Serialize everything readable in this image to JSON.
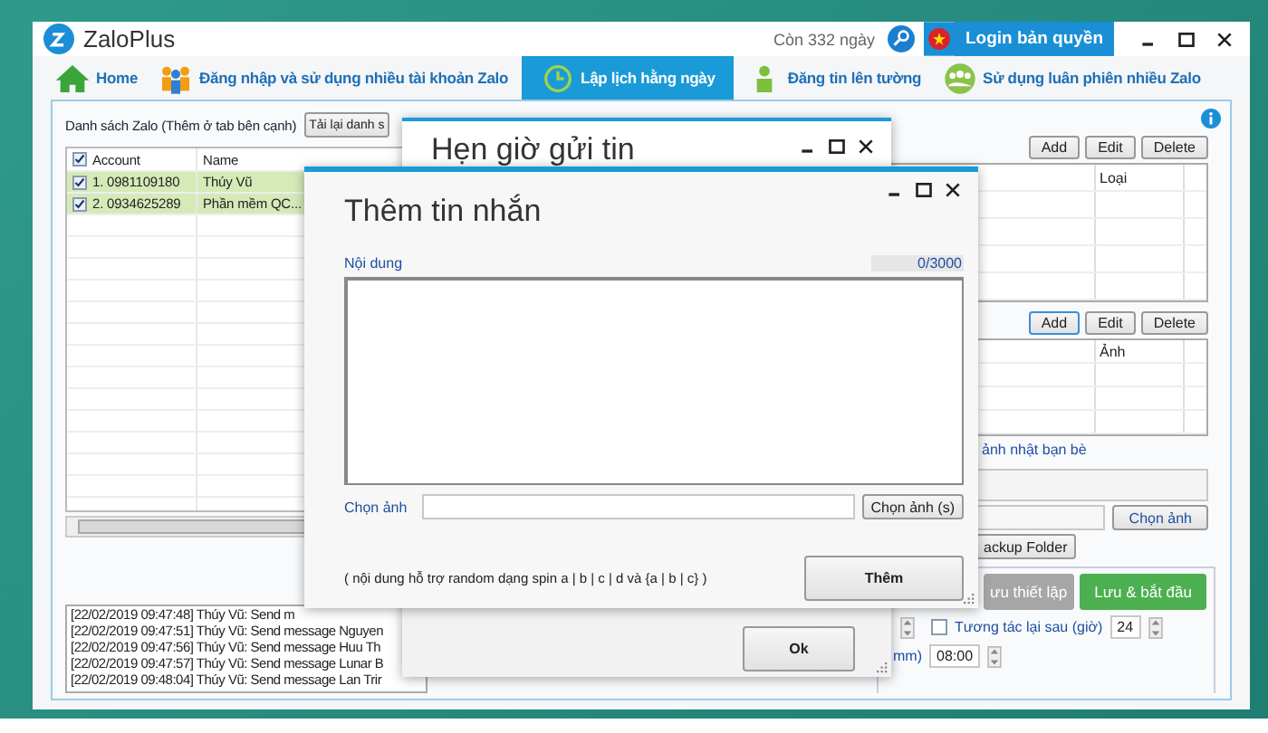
{
  "window": {
    "title": "ZaloPlus",
    "license_days": "Còn 332 ngày",
    "license_button": "Login bản quyền"
  },
  "tabs": [
    {
      "label": "Home",
      "selected": false
    },
    {
      "label": "Đăng nhập và sử dụng nhiều tài khoản Zalo",
      "selected": false
    },
    {
      "label": "Lập lịch hằng ngày",
      "selected": true
    },
    {
      "label": "Đăng tin lên tường",
      "selected": false
    },
    {
      "label": "Sử dụng luân phiên nhiều Zalo",
      "selected": false
    }
  ],
  "accounts_panel": {
    "title": "Danh sách Zalo (Thêm ở tab bên cạnh)",
    "reload_button": "Tải lại danh s",
    "header_checked": true,
    "columns": [
      "Account",
      "Name"
    ],
    "rows": [
      {
        "account": "1. 0981109180",
        "name": "Thúy Vũ",
        "checked": true
      },
      {
        "account": "2. 0934625289",
        "name": "Phần mềm QC...",
        "checked": true
      }
    ]
  },
  "log": [
    "[22/02/2019 09:47:48] Thúy Vũ: Send m",
    "[22/02/2019 09:47:51] Thúy Vũ: Send message Nguyen",
    "[22/02/2019 09:47:56] Thúy Vũ: Send message Huu Th",
    "[22/02/2019 09:47:57] Thúy Vũ: Send message Lunar B",
    "[22/02/2019 09:48:04] Thúy Vũ: Send message Lan Trir"
  ],
  "messages_panel": {
    "buttons": [
      "Add",
      "Edit",
      "Delete"
    ],
    "columns": [
      "Loại"
    ]
  },
  "images_panel": {
    "buttons": [
      "Add",
      "Edit",
      "Delete"
    ],
    "columns": [
      "Ảnh"
    ]
  },
  "friend_section": {
    "label": "ảnh nhật bạn bè",
    "choose_button": "Chọn ảnh",
    "backup_button": "ackup Folder"
  },
  "actions": {
    "save_button": "ưu thiết lập",
    "start_button": "Lưu & bắt đầu"
  },
  "interact": {
    "checked": false,
    "label": "Tương tác lại sau (giờ)",
    "value": "24"
  },
  "time": {
    "label": "mm)",
    "value": "08:00"
  },
  "schedule_dialog": {
    "title": "Hẹn giờ gửi tin",
    "ok_button": "Ok"
  },
  "message_dialog": {
    "title": "Thêm tin nhắn",
    "content_label": "Nội dung",
    "counter": "0/3000",
    "image_label": "Chọn ảnh",
    "choose_button": "Chọn ảnh (s)",
    "hint": "( nội dung hỗ trợ random dạng spin a | b | c | d và {a | b | c} )",
    "add_button": "Thêm"
  }
}
